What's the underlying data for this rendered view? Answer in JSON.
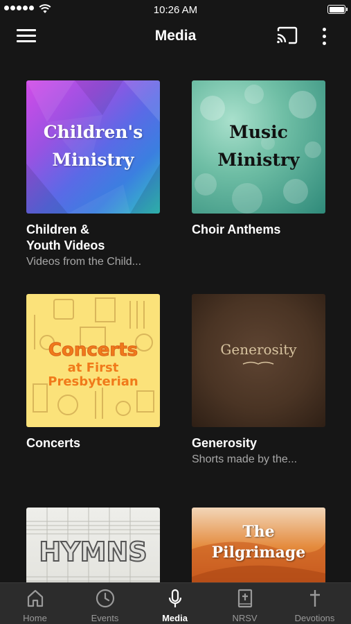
{
  "status_bar": {
    "time": "10:26 AM"
  },
  "header": {
    "title": "Media"
  },
  "cards": [
    {
      "title": "Children &\nYouth Videos",
      "subtitle": "Videos from the Child...",
      "thumb_line1": "Children's",
      "thumb_line2": "Ministry"
    },
    {
      "title": "Choir Anthems",
      "subtitle": "",
      "thumb_line1": "Music",
      "thumb_line2": "Ministry"
    },
    {
      "title": "Concerts",
      "subtitle": "",
      "thumb_line1": "Concerts",
      "thumb_line2": "at First",
      "thumb_line3": "Presbyterian"
    },
    {
      "title": "Generosity",
      "subtitle": "Shorts made by the...",
      "thumb_line1": "Generosity"
    },
    {
      "title": "",
      "subtitle": "",
      "thumb_line1": "HYMNS"
    },
    {
      "title": "",
      "subtitle": "",
      "thumb_line1": "The",
      "thumb_line2": "Pilgrimage"
    }
  ],
  "tabs": [
    {
      "label": "Home",
      "icon": "home-icon"
    },
    {
      "label": "Events",
      "icon": "clock-icon"
    },
    {
      "label": "Media",
      "icon": "microphone-icon",
      "active": true
    },
    {
      "label": "NRSV",
      "icon": "bible-icon"
    },
    {
      "label": "Devotions",
      "icon": "cross-icon"
    }
  ],
  "colors": {
    "background": "#161616",
    "tabbar": "#2c2c2c",
    "active": "#ffffff",
    "inactive": "#9a9a9a",
    "subtitle": "#a8a8a8"
  }
}
